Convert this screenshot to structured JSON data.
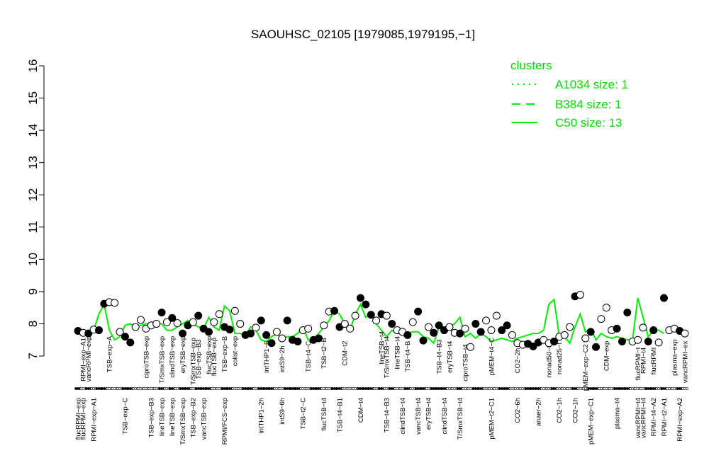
{
  "chart_data": {
    "type": "line",
    "title": "SAOUHSC_02105 [1979085,1979195,−1]",
    "xlabel": "",
    "ylabel": "",
    "ylim": [
      7,
      16
    ],
    "yticks": [
      7,
      8,
      9,
      10,
      11,
      12,
      13,
      14,
      15,
      16
    ],
    "grid": false,
    "legend": {
      "title": "clusters",
      "placement": "top-right",
      "entries": [
        {
          "label": "A1034 size: 1",
          "style": "dotted"
        },
        {
          "label": "B384 size: 1",
          "style": "dashed"
        },
        {
          "label": "C50 size: 13",
          "style": "solid"
        }
      ]
    },
    "line_color": "#00ee00",
    "point_colors": {
      "filled": "#000000",
      "open": "#ffffff"
    },
    "line_points": [
      7.75,
      7.7,
      7.7,
      7.8,
      8.3,
      8.6,
      7.8,
      7.5,
      7.6,
      7.95,
      8.0,
      7.9,
      7.95,
      8.0,
      8.0,
      8.0,
      8.0,
      7.8,
      7.8,
      7.9,
      8.0,
      8.1,
      8.0,
      7.9,
      7.85,
      8.2,
      7.9,
      7.8,
      8.55,
      8.4,
      7.7,
      7.7,
      7.65,
      7.9,
      7.8,
      7.5,
      7.45,
      7.6,
      7.7,
      7.55,
      7.6,
      7.6,
      7.7,
      7.9,
      7.5,
      7.45,
      7.7,
      7.9,
      8.1,
      8.4,
      8.3,
      8.0,
      7.8,
      8.3,
      8.6,
      8.2,
      8.3,
      8.0,
      7.8,
      7.6,
      7.8,
      7.7,
      7.7,
      7.7,
      7.75,
      7.75,
      7.6,
      7.55,
      7.4,
      7.9,
      7.85,
      7.9,
      8.0,
      8.2,
      7.6,
      7.7,
      7.55,
      7.7,
      7.6,
      7.45,
      7.5,
      7.55,
      7.5,
      7.45,
      7.55,
      7.6,
      7.65,
      7.7,
      7.7,
      7.8,
      8.6,
      8.75,
      7.6,
      7.6,
      7.4,
      7.9,
      8.3,
      7.75,
      7.85,
      7.5,
      7.7,
      7.6,
      7.55,
      7.6,
      7.55,
      7.5,
      7.5,
      8.8,
      8.2,
      7.6,
      7.8,
      7.8,
      7.7
    ],
    "points": [
      {
        "x": 1,
        "y": 7.78,
        "filled": true
      },
      {
        "x": 2,
        "y": 7.72,
        "filled": false
      },
      {
        "x": 3,
        "y": 7.7,
        "filled": true
      },
      {
        "x": 4,
        "y": 7.82,
        "filled": false
      },
      {
        "x": 5,
        "y": 7.8,
        "filled": true
      },
      {
        "x": 6,
        "y": 8.62,
        "filled": true
      },
      {
        "x": 7,
        "y": 8.67,
        "filled": false
      },
      {
        "x": 8,
        "y": 8.65,
        "filled": false
      },
      {
        "x": 9,
        "y": 7.75,
        "filled": false
      },
      {
        "x": 10,
        "y": 7.6,
        "filled": true
      },
      {
        "x": 11,
        "y": 7.42,
        "filled": true
      },
      {
        "x": 12,
        "y": 7.9,
        "filled": false
      },
      {
        "x": 13,
        "y": 8.12,
        "filled": false
      },
      {
        "x": 14,
        "y": 7.85,
        "filled": false
      },
      {
        "x": 15,
        "y": 7.95,
        "filled": false
      },
      {
        "x": 16,
        "y": 8.0,
        "filled": false
      },
      {
        "x": 17,
        "y": 8.35,
        "filled": true
      },
      {
        "x": 18,
        "y": 8.05,
        "filled": false
      },
      {
        "x": 19,
        "y": 8.18,
        "filled": true
      },
      {
        "x": 20,
        "y": 8.02,
        "filled": false
      },
      {
        "x": 21,
        "y": 7.7,
        "filled": true
      },
      {
        "x": 22,
        "y": 7.95,
        "filled": true
      },
      {
        "x": 23,
        "y": 8.05,
        "filled": false
      },
      {
        "x": 24,
        "y": 8.25,
        "filled": true
      },
      {
        "x": 25,
        "y": 7.85,
        "filled": true
      },
      {
        "x": 26,
        "y": 7.75,
        "filled": true
      },
      {
        "x": 27,
        "y": 8.05,
        "filled": false
      },
      {
        "x": 28,
        "y": 8.3,
        "filled": false
      },
      {
        "x": 29,
        "y": 7.9,
        "filled": true
      },
      {
        "x": 30,
        "y": 7.82,
        "filled": true
      },
      {
        "x": 31,
        "y": 8.4,
        "filled": false
      },
      {
        "x": 32,
        "y": 8.0,
        "filled": false
      },
      {
        "x": 33,
        "y": 7.65,
        "filled": true
      },
      {
        "x": 34,
        "y": 7.7,
        "filled": true
      },
      {
        "x": 35,
        "y": 7.88,
        "filled": false
      },
      {
        "x": 36,
        "y": 8.1,
        "filled": true
      },
      {
        "x": 37,
        "y": 7.65,
        "filled": true
      },
      {
        "x": 38,
        "y": 7.4,
        "filled": true
      },
      {
        "x": 39,
        "y": 7.75,
        "filled": false
      },
      {
        "x": 40,
        "y": 7.55,
        "filled": false
      },
      {
        "x": 41,
        "y": 8.1,
        "filled": true
      },
      {
        "x": 42,
        "y": 7.5,
        "filled": true
      },
      {
        "x": 43,
        "y": 7.45,
        "filled": true
      },
      {
        "x": 44,
        "y": 7.8,
        "filled": false
      },
      {
        "x": 45,
        "y": 7.85,
        "filled": false
      },
      {
        "x": 46,
        "y": 7.5,
        "filled": true
      },
      {
        "x": 47,
        "y": 7.55,
        "filled": true
      },
      {
        "x": 48,
        "y": 7.95,
        "filled": false
      },
      {
        "x": 49,
        "y": 8.38,
        "filled": false
      },
      {
        "x": 50,
        "y": 8.4,
        "filled": true
      },
      {
        "x": 51,
        "y": 7.9,
        "filled": true
      },
      {
        "x": 52,
        "y": 8.0,
        "filled": false
      },
      {
        "x": 53,
        "y": 7.85,
        "filled": false
      },
      {
        "x": 54,
        "y": 8.25,
        "filled": false
      },
      {
        "x": 55,
        "y": 8.8,
        "filled": true
      },
      {
        "x": 56,
        "y": 8.6,
        "filled": true
      },
      {
        "x": 57,
        "y": 8.28,
        "filled": true
      },
      {
        "x": 58,
        "y": 8.1,
        "filled": false
      },
      {
        "x": 59,
        "y": 8.3,
        "filled": true
      },
      {
        "x": 60,
        "y": 8.25,
        "filled": false
      },
      {
        "x": 61,
        "y": 8.0,
        "filled": true
      },
      {
        "x": 62,
        "y": 7.8,
        "filled": false
      },
      {
        "x": 63,
        "y": 7.75,
        "filled": false
      },
      {
        "x": 64,
        "y": 7.65,
        "filled": true
      },
      {
        "x": 65,
        "y": 8.05,
        "filled": false
      },
      {
        "x": 66,
        "y": 8.38,
        "filled": true
      },
      {
        "x": 67,
        "y": 7.48,
        "filled": true
      },
      {
        "x": 68,
        "y": 7.9,
        "filled": false
      },
      {
        "x": 69,
        "y": 7.72,
        "filled": true
      },
      {
        "x": 70,
        "y": 7.95,
        "filled": true
      },
      {
        "x": 71,
        "y": 7.8,
        "filled": true
      },
      {
        "x": 72,
        "y": 7.9,
        "filled": false
      },
      {
        "x": 73,
        "y": 7.72,
        "filled": false
      },
      {
        "x": 74,
        "y": 7.7,
        "filled": true
      },
      {
        "x": 75,
        "y": 7.85,
        "filled": false
      },
      {
        "x": 76,
        "y": 7.28,
        "filled": false
      },
      {
        "x": 77,
        "y": 8.0,
        "filled": true
      },
      {
        "x": 78,
        "y": 7.75,
        "filled": true
      },
      {
        "x": 79,
        "y": 8.1,
        "filled": false
      },
      {
        "x": 80,
        "y": 7.8,
        "filled": false
      },
      {
        "x": 81,
        "y": 8.25,
        "filled": false
      },
      {
        "x": 82,
        "y": 7.8,
        "filled": true
      },
      {
        "x": 83,
        "y": 7.95,
        "filled": true
      },
      {
        "x": 84,
        "y": 7.65,
        "filled": false
      },
      {
        "x": 85,
        "y": 7.4,
        "filled": false
      },
      {
        "x": 86,
        "y": 7.35,
        "filled": false
      },
      {
        "x": 87,
        "y": 7.38,
        "filled": true
      },
      {
        "x": 88,
        "y": 7.3,
        "filled": true
      },
      {
        "x": 89,
        "y": 7.42,
        "filled": true
      },
      {
        "x": 90,
        "y": 7.5,
        "filled": false
      },
      {
        "x": 91,
        "y": 7.4,
        "filled": false
      },
      {
        "x": 92,
        "y": 7.45,
        "filled": true
      },
      {
        "x": 93,
        "y": 7.6,
        "filled": false
      },
      {
        "x": 94,
        "y": 7.65,
        "filled": false
      },
      {
        "x": 95,
        "y": 7.9,
        "filled": false
      },
      {
        "x": 96,
        "y": 8.85,
        "filled": true
      },
      {
        "x": 97,
        "y": 8.9,
        "filled": false
      },
      {
        "x": 98,
        "y": 7.55,
        "filled": false
      },
      {
        "x": 99,
        "y": 7.75,
        "filled": true
      },
      {
        "x": 100,
        "y": 7.28,
        "filled": true
      },
      {
        "x": 101,
        "y": 8.15,
        "filled": false
      },
      {
        "x": 102,
        "y": 8.5,
        "filled": false
      },
      {
        "x": 103,
        "y": 7.8,
        "filled": false
      },
      {
        "x": 104,
        "y": 7.85,
        "filled": true
      },
      {
        "x": 105,
        "y": 7.45,
        "filled": true
      },
      {
        "x": 106,
        "y": 8.35,
        "filled": true
      },
      {
        "x": 107,
        "y": 7.45,
        "filled": false
      },
      {
        "x": 108,
        "y": 7.5,
        "filled": false
      },
      {
        "x": 109,
        "y": 7.88,
        "filled": false
      },
      {
        "x": 110,
        "y": 7.45,
        "filled": true
      },
      {
        "x": 111,
        "y": 7.8,
        "filled": true
      },
      {
        "x": 112,
        "y": 7.42,
        "filled": false
      },
      {
        "x": 113,
        "y": 8.8,
        "filled": true
      },
      {
        "x": 114,
        "y": 7.8,
        "filled": false
      },
      {
        "x": 115,
        "y": 7.85,
        "filled": false
      },
      {
        "x": 116,
        "y": 7.78,
        "filled": true
      },
      {
        "x": 117,
        "y": 7.7,
        "filled": false
      }
    ],
    "inplot_labels": [
      {
        "text": "RPMI−exp−A1",
        "x": 2,
        "y": 7.7
      },
      {
        "text": "vancRPMI−exp",
        "x": 3,
        "y": 7.75
      },
      {
        "text": "TSB−exp−A",
        "x": 7,
        "y": 7.75
      },
      {
        "text": "ciproTSB−exp",
        "x": 14,
        "y": 7.75
      },
      {
        "text": "T/SmxTSB−exp",
        "x": 17,
        "y": 7.75
      },
      {
        "text": "clindTSB−exp",
        "x": 19,
        "y": 7.75
      },
      {
        "text": "eryTSB−exp",
        "x": 21,
        "y": 7.75
      },
      {
        "text": "T/SmxTSB−exp",
        "x": 23,
        "y": 7.7
      },
      {
        "text": "TSB−exp−B3",
        "x": 24,
        "y": 7.65
      },
      {
        "text": "flucTSB−exp",
        "x": 26,
        "y": 7.75
      },
      {
        "text": "flucTSB−exp",
        "x": 27,
        "y": 7.7
      },
      {
        "text": "TSB−exp−B",
        "x": 29,
        "y": 7.75
      },
      {
        "text": "colist−exp",
        "x": 31,
        "y": 7.75
      },
      {
        "text": "intTHP1−6",
        "x": 37,
        "y": 7.6
      },
      {
        "text": "intS9−2h",
        "x": 40,
        "y": 7.45
      },
      {
        "text": "TSB−t4−C",
        "x": 45,
        "y": 7.6
      },
      {
        "text": "TSB−t2−B",
        "x": 48,
        "y": 7.7
      },
      {
        "text": "CDM−t2",
        "x": 52,
        "y": 7.6
      },
      {
        "text": "lineTSB−t4",
        "x": 59,
        "y": 7.9
      },
      {
        "text": "T/SmxTSB−t4",
        "x": 60,
        "y": 7.75
      },
      {
        "text": "lineTSB−t4",
        "x": 62,
        "y": 7.75
      },
      {
        "text": "TSB−t4−B",
        "x": 64,
        "y": 7.6
      },
      {
        "text": "TSB−t4−B3",
        "x": 70,
        "y": 7.65
      },
      {
        "text": "eryTSB−t4",
        "x": 72,
        "y": 7.6
      },
      {
        "text": "ciproTSB−t4",
        "x": 75,
        "y": 7.5
      },
      {
        "text": "pMEM−t4−C",
        "x": 80,
        "y": 7.7
      },
      {
        "text": "CO2−2h",
        "x": 85,
        "y": 7.38
      },
      {
        "text": "nonad50−t",
        "x": 91,
        "y": 7.45
      },
      {
        "text": "nonad25−t",
        "x": 93,
        "y": 7.55
      },
      {
        "text": "pMEM−exp−C2",
        "x": 98,
        "y": 7.5
      },
      {
        "text": "CDM−exp",
        "x": 102,
        "y": 7.6
      },
      {
        "text": "flucRPMI−t",
        "x": 108,
        "y": 7.4
      },
      {
        "text": "RPMI−t4",
        "x": 109,
        "y": 7.4
      },
      {
        "text": "flucRPMI",
        "x": 111,
        "y": 7.4
      },
      {
        "text": "plasma−exp",
        "x": 115,
        "y": 7.65
      },
      {
        "text": "vancRPMI−ex",
        "x": 117,
        "y": 7.6
      }
    ],
    "condition_labels": [
      {
        "text": "flucRPMI−exp",
        "x": 1
      },
      {
        "text": "flucRPMI−exp",
        "x": 2
      },
      {
        "text": "RPMI−exp−A1",
        "x": 4
      },
      {
        "text": "TSB−exp−C",
        "x": 10
      },
      {
        "text": "TSB−exp−B3",
        "x": 15
      },
      {
        "text": "lineTSB−exp",
        "x": 17
      },
      {
        "text": "lineTSB−exp",
        "x": 19
      },
      {
        "text": "T/SmxTSB−exp",
        "x": 21
      },
      {
        "text": "TSB−exp−B2",
        "x": 23
      },
      {
        "text": "vancTSB−exp",
        "x": 25
      },
      {
        "text": "RPMI/FCS−exp",
        "x": 29
      },
      {
        "text": "intTHP1−2h",
        "x": 36
      },
      {
        "text": "intS9−6h",
        "x": 40
      },
      {
        "text": "TSB−t2−C",
        "x": 44
      },
      {
        "text": "flucTSB−t4",
        "x": 48
      },
      {
        "text": "TSB−t4−B1",
        "x": 51
      },
      {
        "text": "CDM−t4",
        "x": 55
      },
      {
        "text": "TSB−t4−B3",
        "x": 60
      },
      {
        "text": "clindTSB−t4",
        "x": 63
      },
      {
        "text": "vancTSB−t4",
        "x": 66
      },
      {
        "text": "eryTSB−t4",
        "x": 68
      },
      {
        "text": "clindTSB−t4",
        "x": 71
      },
      {
        "text": "T/SmxTSB−t4",
        "x": 74
      },
      {
        "text": "pMEM−t2−C1",
        "x": 80
      },
      {
        "text": "CO2−6h",
        "x": 85
      },
      {
        "text": "anaer−2h",
        "x": 89
      },
      {
        "text": "CO2−1h",
        "x": 93
      },
      {
        "text": "CO2−1h",
        "x": 96
      },
      {
        "text": "pMEM−exp−C1",
        "x": 99
      },
      {
        "text": "plasma−t4",
        "x": 104
      },
      {
        "text": "vancRPMI−t4",
        "x": 108
      },
      {
        "text": "vancRPMI−t4",
        "x": 109
      },
      {
        "text": "RPMI−t4−A2",
        "x": 111
      },
      {
        "text": "RPMI−t2−A1",
        "x": 113
      },
      {
        "text": "RPMI−exp−A2",
        "x": 116
      }
    ]
  }
}
